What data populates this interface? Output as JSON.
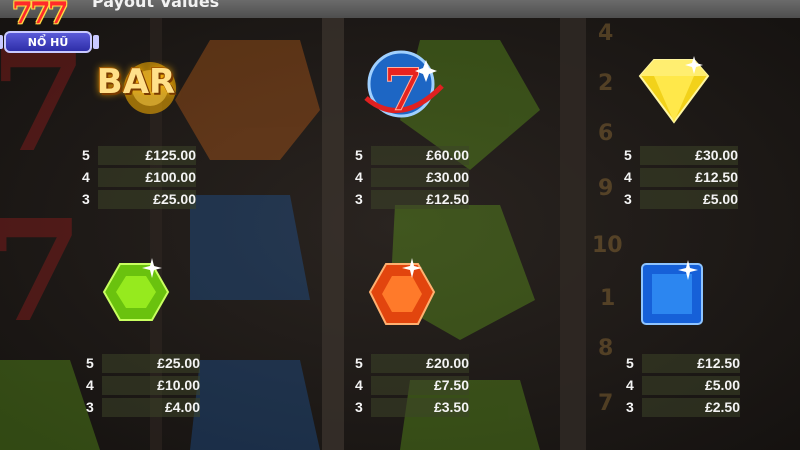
{
  "header": {
    "title": "Payout Values"
  },
  "logo": {
    "numerals": "777",
    "badge_label": "NỔ HŨ"
  },
  "colors": {
    "accent_gold": "#ffd24a",
    "bar_text": "#ffe08a",
    "strip": "#3c4428",
    "top_bar": "#5a5a5a"
  },
  "symbols": [
    {
      "icon": "bar-symbol-icon",
      "label": "BAR",
      "payouts": [
        {
          "count": "5",
          "amount": "£125.00"
        },
        {
          "count": "4",
          "amount": "£100.00"
        },
        {
          "count": "3",
          "amount": "£25.00"
        }
      ]
    },
    {
      "icon": "red-seven-icon",
      "payouts": [
        {
          "count": "5",
          "amount": "£60.00"
        },
        {
          "count": "4",
          "amount": "£30.00"
        },
        {
          "count": "3",
          "amount": "£12.50"
        }
      ]
    },
    {
      "icon": "yellow-diamond-icon",
      "payouts": [
        {
          "count": "5",
          "amount": "£30.00"
        },
        {
          "count": "4",
          "amount": "£12.50"
        },
        {
          "count": "3",
          "amount": "£5.00"
        }
      ]
    },
    {
      "icon": "green-gem-icon",
      "payouts": [
        {
          "count": "5",
          "amount": "£25.00"
        },
        {
          "count": "4",
          "amount": "£10.00"
        },
        {
          "count": "3",
          "amount": "£4.00"
        }
      ]
    },
    {
      "icon": "orange-gem-icon",
      "payouts": [
        {
          "count": "5",
          "amount": "£20.00"
        },
        {
          "count": "4",
          "amount": "£7.50"
        },
        {
          "count": "3",
          "amount": "£3.50"
        }
      ]
    },
    {
      "icon": "blue-gem-icon",
      "payouts": [
        {
          "count": "5",
          "amount": "£12.50"
        },
        {
          "count": "4",
          "amount": "£5.00"
        },
        {
          "count": "3",
          "amount": "£2.50"
        }
      ]
    }
  ]
}
